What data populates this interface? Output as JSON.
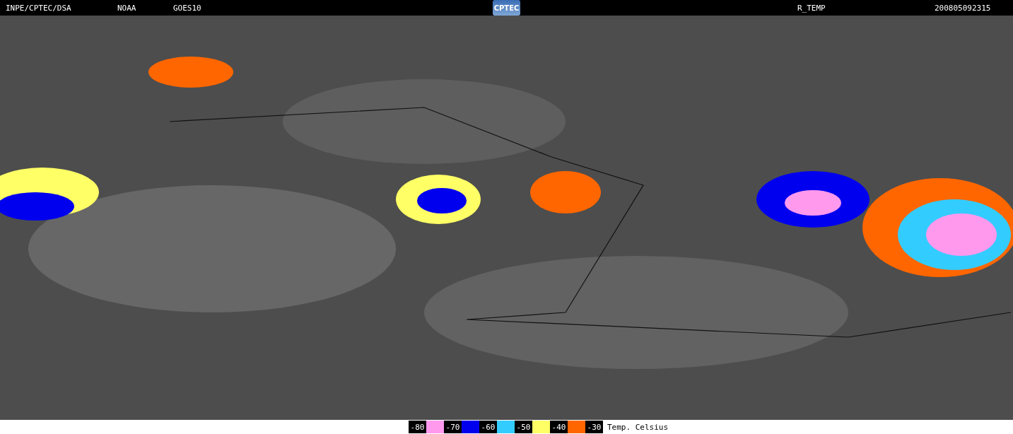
{
  "header": {
    "source": "INPE/CPTEC/DSA",
    "agency": "NOAA",
    "satellite": "GOES10",
    "logo": "CPTEC",
    "product": "R_TEMP",
    "timestamp": "200805092315"
  },
  "legend": {
    "steps": [
      {
        "kind": "label",
        "text": "-80"
      },
      {
        "kind": "swatch",
        "color": "#ff99ee"
      },
      {
        "kind": "label",
        "text": "-70"
      },
      {
        "kind": "swatch",
        "color": "#0000ee"
      },
      {
        "kind": "label",
        "text": "-60"
      },
      {
        "kind": "swatch",
        "color": "#33ccff"
      },
      {
        "kind": "label",
        "text": "-50"
      },
      {
        "kind": "swatch",
        "color": "#ffff66"
      },
      {
        "kind": "label",
        "text": "-40"
      },
      {
        "kind": "swatch",
        "color": "#ff6600"
      },
      {
        "kind": "label",
        "text": "-30"
      }
    ],
    "caption": "Temp. Celsius"
  }
}
